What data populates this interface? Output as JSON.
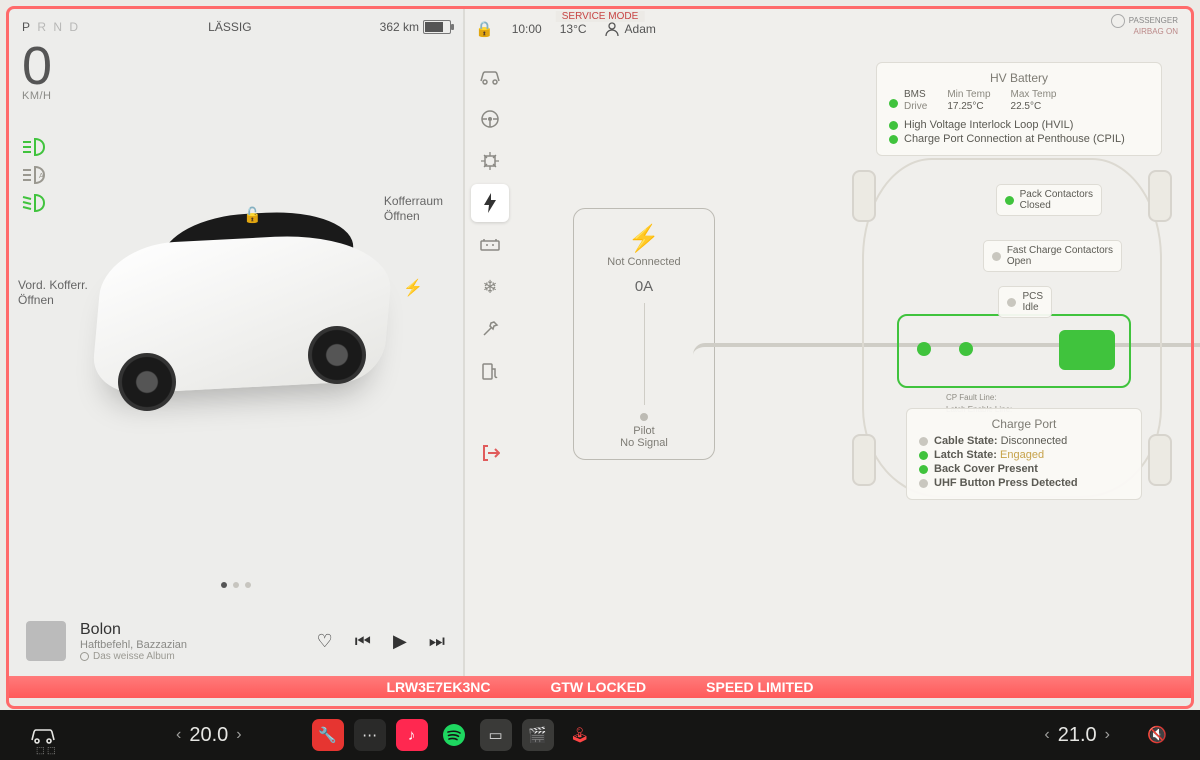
{
  "mode_label": "SERVICE MODE",
  "left": {
    "gear": [
      "P",
      "R",
      "N",
      "D"
    ],
    "gear_active": 0,
    "profile": "LÄSSIG",
    "range": "362 km",
    "speed": "0",
    "speed_unit": "KM/H",
    "frunk_label": "Vord. Kofferr.",
    "frunk_action": "Öffnen",
    "trunk_label": "Kofferraum",
    "trunk_action": "Öffnen"
  },
  "media": {
    "title": "Bolon",
    "artist": "Haftbefehl, Bazzazian",
    "album": "Das weisse Album"
  },
  "right": {
    "time": "10:00",
    "temp": "13°C",
    "user": "Adam",
    "airbag_l1": "PASSENGER",
    "airbag_l2": "AIRBAG ON"
  },
  "charge_panel": {
    "status": "Not Connected",
    "amps": "0A",
    "pilot_l1": "Pilot",
    "pilot_l2": "No Signal"
  },
  "hv": {
    "title": "HV Battery",
    "bms_l": "BMS",
    "bms_s": "Drive",
    "min_l": "Min Temp",
    "min_v": "17.25°C",
    "max_l": "Max Temp",
    "max_v": "22.5°C",
    "hvil": "High Voltage Interlock Loop (HVIL)",
    "cpil": "Charge Port Connection at Penthouse (CPIL)"
  },
  "pack": {
    "l1": "Pack Contactors",
    "l2": "Closed"
  },
  "fast": {
    "l1": "Fast Charge Contactors",
    "l2": "Open"
  },
  "pcs": {
    "l1": "PCS",
    "l2": "Idle"
  },
  "port_lines": {
    "fault": "CP Fault Line:",
    "latch": "Latch Enable Line:"
  },
  "cp": {
    "title": "Charge Port",
    "r1": "Cable State:",
    "r1v": "Disconnected",
    "r2": "Latch State:",
    "r2v": "Engaged",
    "r3": "Back Cover Present",
    "r4": "UHF Button Press Detected"
  },
  "alert": {
    "vin": "LRW3E7EK3NC",
    "gtw": "GTW LOCKED",
    "speed": "SPEED LIMITED"
  },
  "bottom": {
    "tempL": "20.0",
    "tempR": "21.0"
  }
}
